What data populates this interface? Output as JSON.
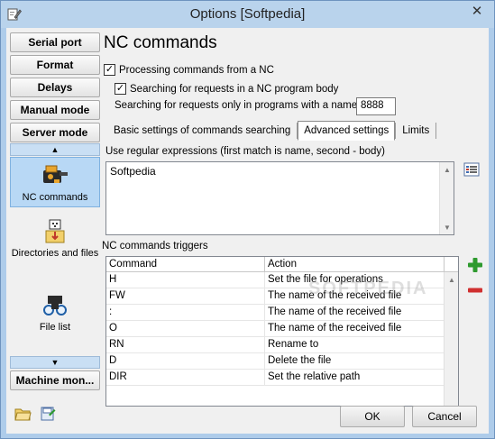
{
  "window": {
    "title": "Options [Softpedia]",
    "close_glyph": "✕"
  },
  "nav": {
    "buttons": [
      "Serial port",
      "Format",
      "Delays",
      "Manual mode",
      "Server mode"
    ],
    "items": [
      {
        "label": "NC commands",
        "icon": "nc-commands-icon"
      },
      {
        "label": "Directories and files",
        "icon": "directories-icon"
      },
      {
        "label": "File list",
        "icon": "file-list-icon"
      }
    ],
    "bottom_button": "Machine mon...",
    "scroll_up": "▲",
    "scroll_down": "▼"
  },
  "main": {
    "heading": "NC commands",
    "cb_processing": "Processing commands from a NC",
    "cb_searching": "Searching for requests in a NC program body",
    "search_only_label": "Searching for requests only in programs with a name",
    "search_only_value": "8888",
    "tabs": [
      "Basic settings of commands searching",
      "Advanced settings",
      "Limits"
    ],
    "regex_label": "Use regular expressions (first match is name, second - body)",
    "regex_value": "Softpedia",
    "triggers_label": "NC commands triggers",
    "grid": {
      "columns": [
        "Command",
        "Action"
      ],
      "rows": [
        [
          "H",
          "Set the file for operations"
        ],
        [
          "FW",
          "The name of the received file"
        ],
        [
          ":",
          "The name of the received file"
        ],
        [
          "O",
          "The name of the received file"
        ],
        [
          "RN",
          "Rename to"
        ],
        [
          "D",
          "Delete the file"
        ],
        [
          "DIR",
          "Set the relative path"
        ]
      ]
    }
  },
  "buttons": {
    "ok": "OK",
    "cancel": "Cancel"
  },
  "watermark": "SOFTPEDIA",
  "colors": {
    "accent": "#b8d8f5",
    "add": "#2e9a2e",
    "remove": "#d03030"
  }
}
